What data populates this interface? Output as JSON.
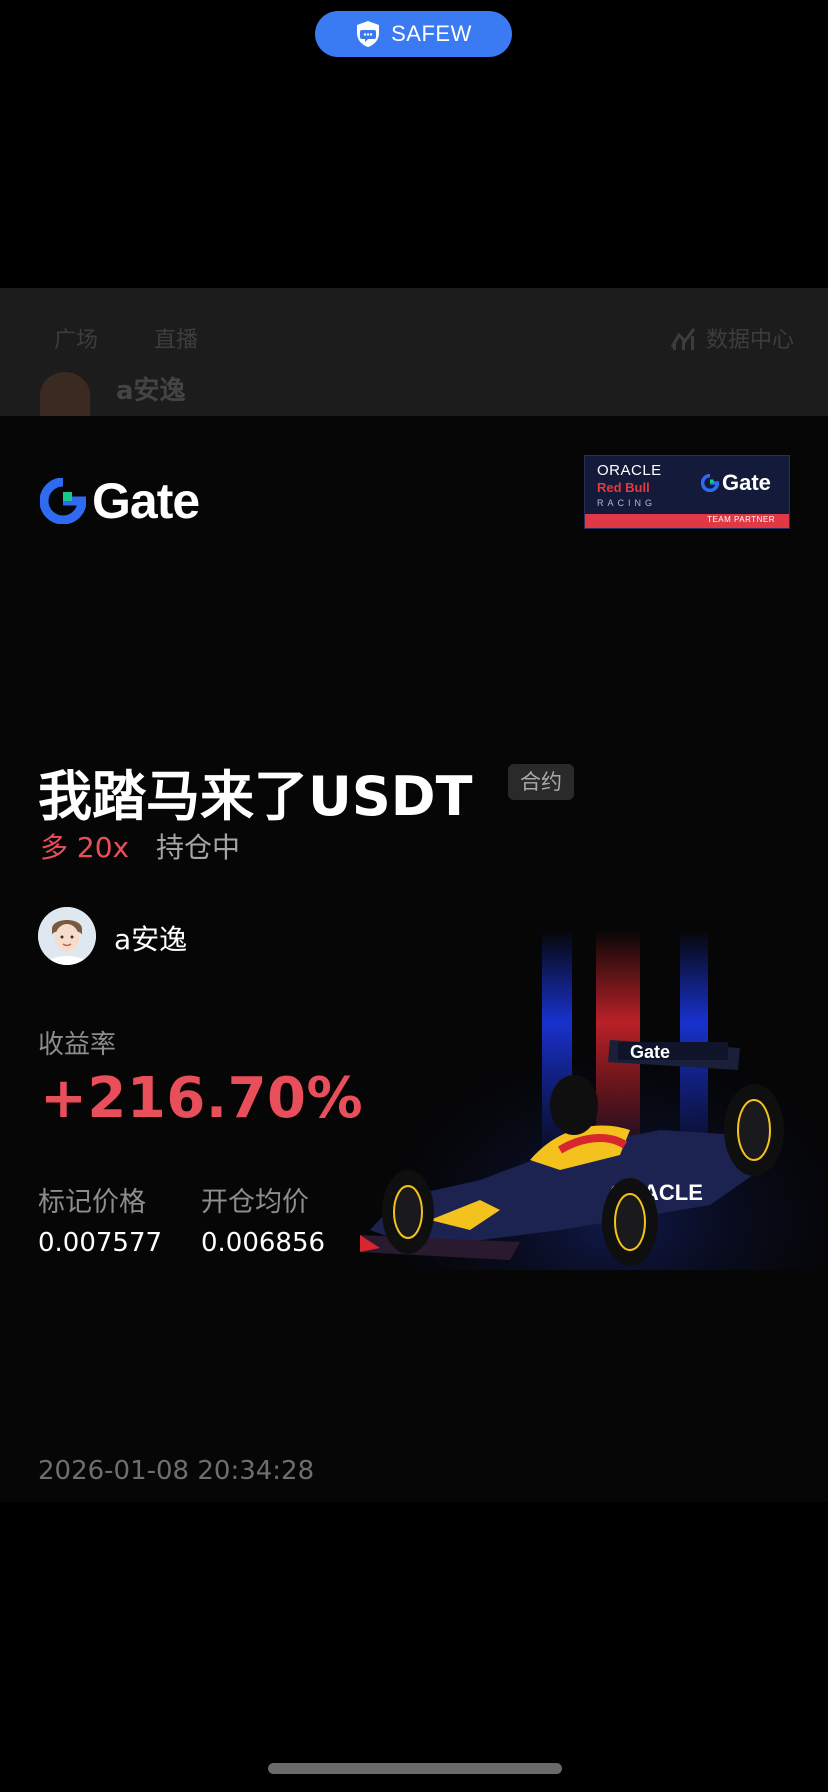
{
  "badge": {
    "label": "SAFEW",
    "icon": "shield-chat-icon",
    "color": "#3a7af3"
  },
  "background_app": {
    "tabs": [
      "广场",
      "直播"
    ],
    "data_center": "数据中心",
    "author_name": "a安逸"
  },
  "card": {
    "brand": "Gate",
    "partner": {
      "line1": "ORACLE",
      "line2": "Red Bull",
      "line3": "RACING",
      "brand": "Gate",
      "footer": "TEAM PARTNER"
    },
    "pair": "我踏马来了USDT",
    "type_tag": "合约",
    "side": "多 20x",
    "position_status": "持仓中",
    "username": "a安逸",
    "roi_label": "收益率",
    "roi_value": "+216.70%",
    "mark_price_label": "标记价格",
    "mark_price": "0.007577",
    "open_price_label": "开仓均价",
    "open_price": "0.006856",
    "timestamp": "2026-01-08 20:34:28",
    "colors": {
      "profit": "#e84f5b",
      "muted": "#8d8d8d"
    }
  }
}
